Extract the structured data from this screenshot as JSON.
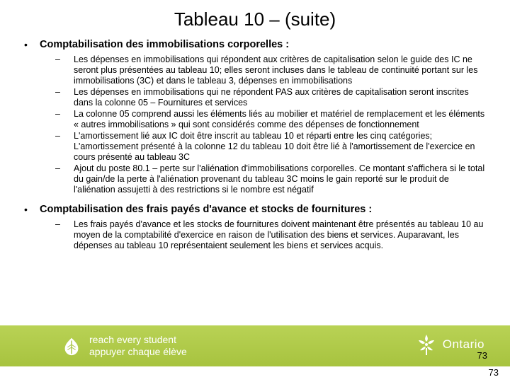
{
  "title": "Tableau 10 – (suite)",
  "sections": [
    {
      "heading": "Comptabilisation des immobilisations corporelles :",
      "items": [
        "Les dépenses en immobilisations qui répondent aux critères de capitalisation selon le guide des IC ne seront plus présentées au tableau 10; elles seront incluses dans le tableau de continuité portant sur les immobilisations (3C) et dans le tableau 3, dépenses en immobilisations",
        "Les dépenses en immobilisations qui ne répondent PAS aux critères de capitalisation seront inscrites dans la colonne 05 – Fournitures et services",
        "La colonne 05 comprend aussi les éléments liés au mobilier et matériel de remplacement et les éléments « autres immobilisations » qui sont considérés comme des dépenses de fonctionnement",
        "L'amortissement lié aux IC doit être inscrit au tableau 10 et réparti entre les cinq catégories; L'amortissement présenté à la colonne 12 du tableau 10 doit être lié à l'amortissement de l'exercice en cours présenté au tableau 3C",
        "Ajout du poste 80.1 – perte sur l'aliénation d'immobilisations corporelles. Ce montant s'affichera si le total du gain/de la perte à l'aliénation provenant du tableau 3C moins le gain reporté sur le produit de l'aliénation assujetti à des restrictions si le nombre est négatif"
      ]
    },
    {
      "heading": "Comptabilisation des frais payés d'avance et stocks de fournitures :",
      "items": [
        "Les frais payés d'avance et les stocks de fournitures doivent maintenant être présentés au tableau 10 au moyen de la comptabilité d'exercice en raison de l'utilisation des biens et services. Auparavant, les dépenses au tableau 10 représentaient seulement les biens et services acquis."
      ]
    }
  ],
  "footer": {
    "reach_en": "reach every student",
    "reach_fr": "appuyer chaque élève",
    "ontario": "Ontario"
  },
  "page_upper": "73",
  "page_lower": "73"
}
